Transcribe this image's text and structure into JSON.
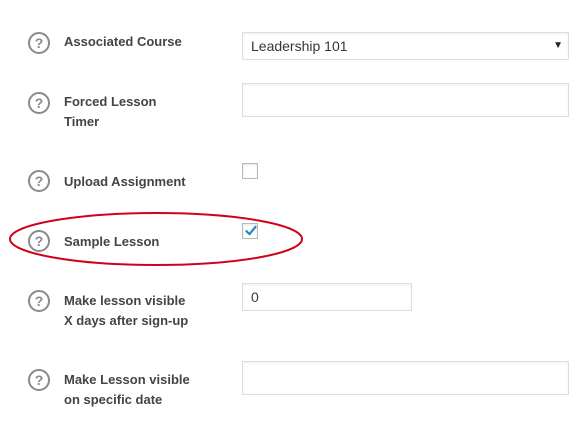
{
  "fields": {
    "associated_course": {
      "label": "Associated Course",
      "value": "Leadership 101",
      "help_icon": "question-circle-icon",
      "dropdown_icon": "caret-down-icon",
      "arrow_glyph": "▼"
    },
    "forced_lesson_timer": {
      "label_line1": "Forced Lesson",
      "label_line2": "Timer",
      "value": "",
      "help_icon": "question-circle-icon"
    },
    "upload_assignment": {
      "label": "Upload Assignment",
      "checked": false,
      "help_icon": "question-circle-icon"
    },
    "sample_lesson": {
      "label": "Sample Lesson",
      "checked": true,
      "help_icon": "question-circle-icon",
      "highlight_color": "#d0021b"
    },
    "visible_after_days": {
      "label_line1": "Make lesson visible",
      "label_line2": "X days after sign-up",
      "value": "0",
      "help_icon": "question-circle-icon"
    },
    "visible_on_date": {
      "label_line1": "Make Lesson visible",
      "label_line2": "on specific date",
      "value": "",
      "help_icon": "question-circle-icon"
    }
  },
  "help_glyph": "?",
  "colors": {
    "label": "#444444",
    "icon": "#8a8a8a",
    "checkmark": "#1e8cbe",
    "highlight": "#d0021b",
    "input_border": "#dddddd"
  }
}
